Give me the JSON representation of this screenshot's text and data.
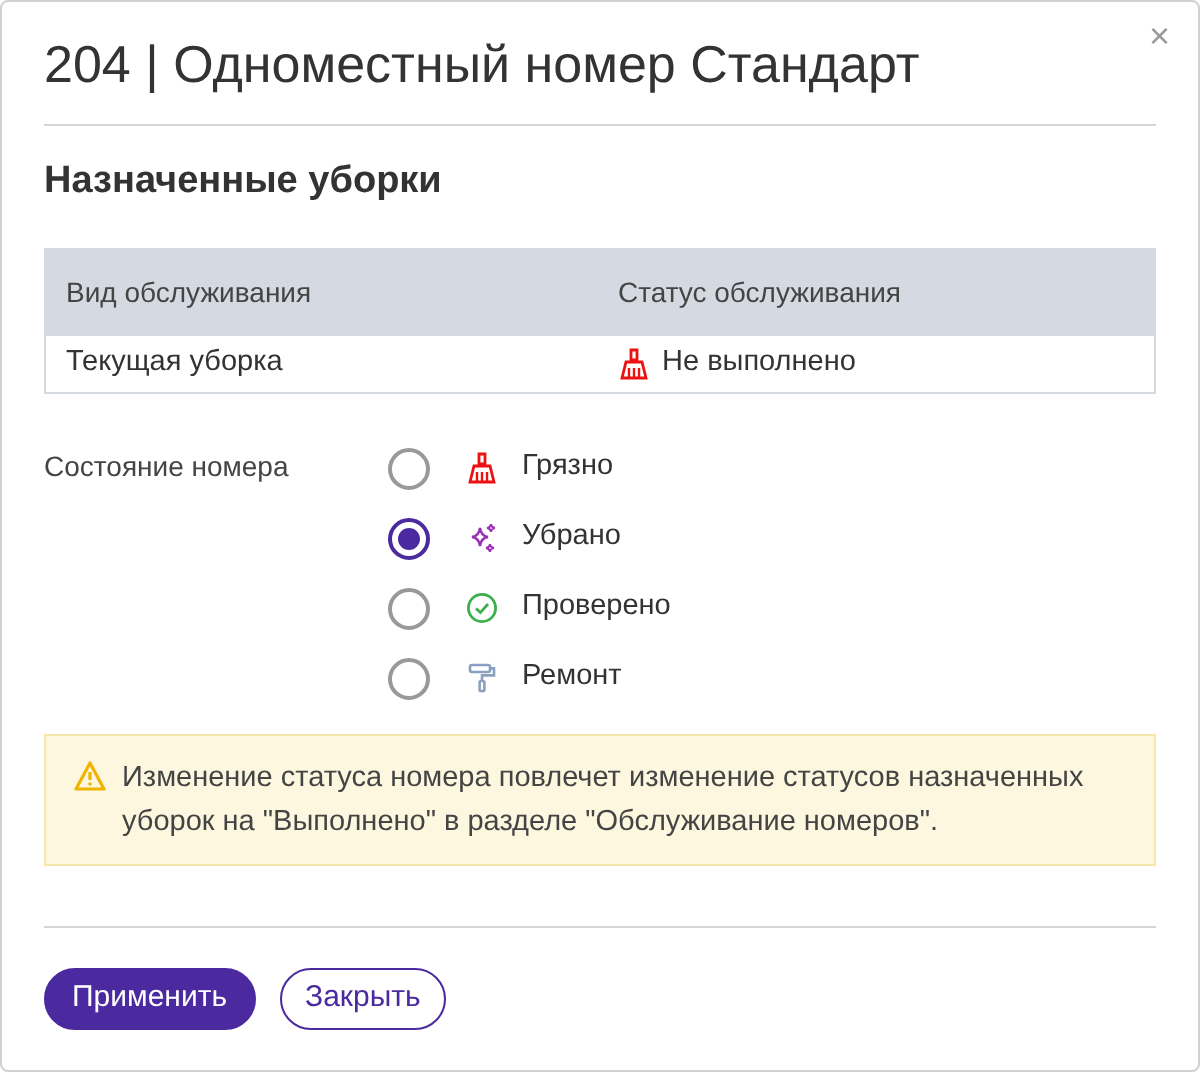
{
  "dialog": {
    "title": "204 | Одноместный номер Стандарт",
    "close": "×"
  },
  "section_title": "Назначенные уборки",
  "table": {
    "columns": [
      "Вид обслуживания",
      "Статус обслуживания"
    ],
    "rows": [
      {
        "service": "Текущая уборка",
        "status": {
          "text": "Не выполнено",
          "kind": "dirty"
        }
      }
    ]
  },
  "room_state": {
    "label": "Состояние номера",
    "options": [
      {
        "label": "Грязно",
        "kind": "dirty",
        "selected": false
      },
      {
        "label": "Убрано",
        "kind": "clean",
        "selected": true
      },
      {
        "label": "Проверено",
        "kind": "inspected",
        "selected": false
      },
      {
        "label": "Ремонт",
        "kind": "repair",
        "selected": false
      }
    ]
  },
  "warning": "Изменение статуса номера повлечет изменение статусов назначенных уборок на \"Выполнено\" в разделе \"Обслуживание номеров\".",
  "buttons": [
    {
      "label": "Применить",
      "kind": "primary"
    },
    {
      "label": "Закрыть",
      "kind": "secondary"
    }
  ]
}
